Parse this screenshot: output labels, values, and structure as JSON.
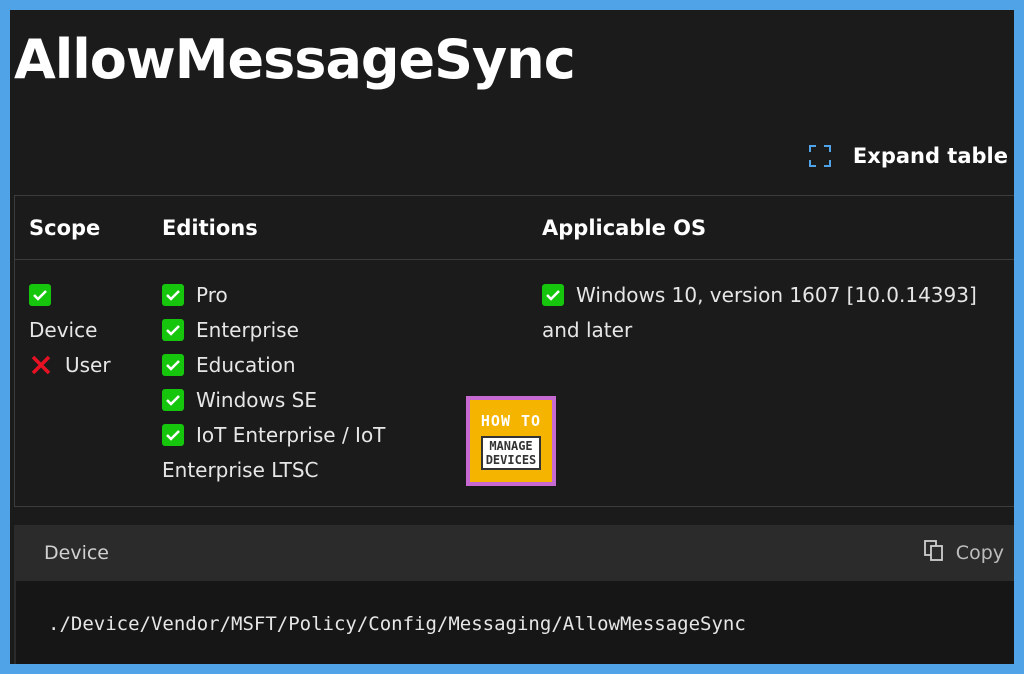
{
  "header": {
    "title": "AllowMessageSync"
  },
  "toolbar": {
    "expand_label": "Expand table"
  },
  "table": {
    "columns": [
      "Scope",
      "Editions",
      "Applicable OS"
    ],
    "scope": {
      "device": "Device",
      "user": "User"
    },
    "editions": [
      "Pro",
      "Enterprise",
      "Education",
      "Windows SE",
      "IoT Enterprise / IoT",
      "Enterprise LTSC"
    ],
    "os": {
      "line1": "Windows 10, version 1607 [10.0.14393]",
      "line2": "and later"
    }
  },
  "logo": {
    "top": "HOW TO",
    "line1": "MANAGE",
    "line2": "DEVICES"
  },
  "code": {
    "label": "Device",
    "copy_label": "Copy",
    "path": "./Device/Vendor/MSFT/Policy/Config/Messaging/AllowMessageSync"
  },
  "colors": {
    "check": "#16c60c",
    "cross": "#e81123",
    "frame": "#4fa3e6"
  }
}
